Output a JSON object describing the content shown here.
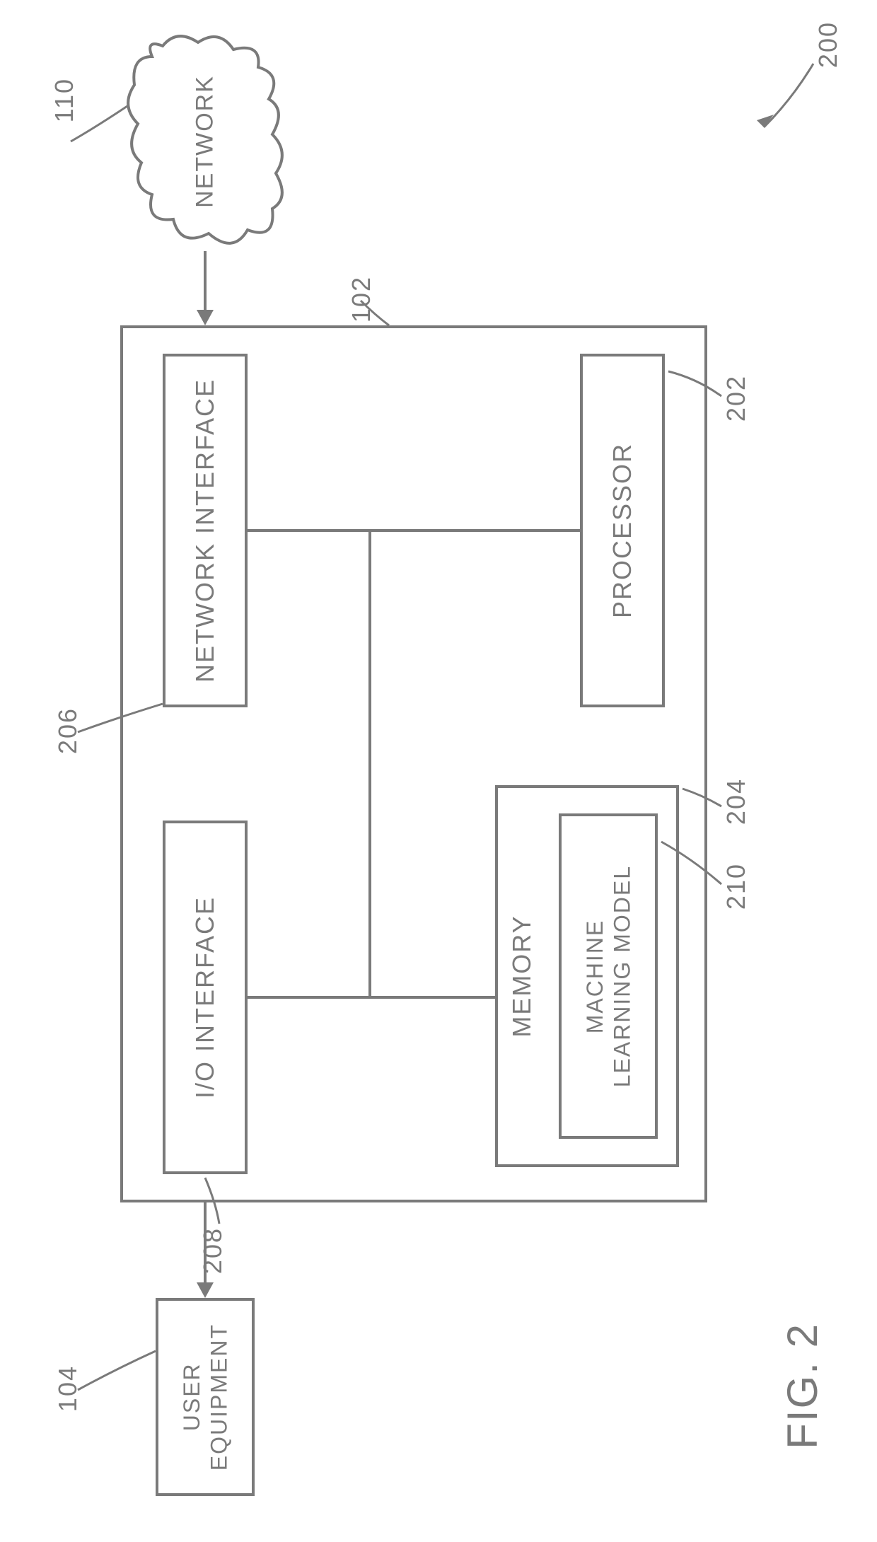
{
  "figure": {
    "number": "200",
    "caption": "FIG. 2"
  },
  "blocks": {
    "network": {
      "label": "NETWORK",
      "ref": "110"
    },
    "device": {
      "ref": "102"
    },
    "processor": {
      "label": "PROCESSOR",
      "ref": "202"
    },
    "memory": {
      "label": "MEMORY",
      "ref": "204"
    },
    "ml_model": {
      "label": "MACHINE\nLEARNING MODEL",
      "ref": "210"
    },
    "network_interface": {
      "label": "NETWORK INTERFACE",
      "ref": "206"
    },
    "io_interface": {
      "label": "I/O INTERFACE",
      "ref": "208"
    },
    "user_equipment": {
      "label": "USER\nEQUIPMENT",
      "ref": "104"
    }
  }
}
